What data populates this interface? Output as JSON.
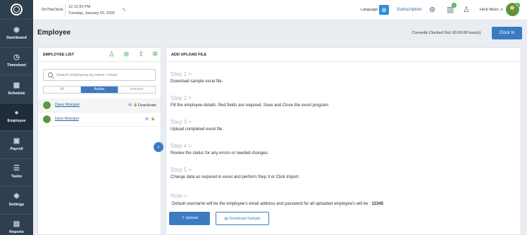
{
  "nav": [
    {
      "label": "Dashboard",
      "icon": "dashboard-icon"
    },
    {
      "label": "Timesheet",
      "icon": "clock-icon"
    },
    {
      "label": "Schedule",
      "icon": "calendar-icon"
    },
    {
      "label": "Employee",
      "icon": "people-icon",
      "active": true
    },
    {
      "label": "Payroll",
      "icon": "wallet-icon"
    },
    {
      "label": "Tasks",
      "icon": "tasks-icon"
    },
    {
      "label": "Settings",
      "icon": "gear-icon"
    },
    {
      "label": "Reports",
      "icon": "reports-icon"
    }
  ],
  "topbar": {
    "app_name": "OnTheClock",
    "time": "12:12:32 PM",
    "date": "Tuesday, January 20, 2026",
    "language_label": "Language",
    "subscription_label": "Subscription",
    "notification_count": "0",
    "user_count": "0",
    "user_name": "Herb Woer...",
    "avatar_badge": "0"
  },
  "page": {
    "title": "Employee",
    "clock_status": "Currently Clocked Out: 00:00:00 hour(s)",
    "clock_in_label": "Clock In"
  },
  "employee_list": {
    "title": "EMPLOYEE LIST",
    "search_placeholder": "Search employees by name / email",
    "filters": [
      "All",
      "Active",
      "Inactive"
    ],
    "active_filter": "Active",
    "employees": [
      {
        "name": "Dave Woerpel",
        "action": "Deactivate"
      },
      {
        "name": "Herb Woerpel",
        "action": ""
      }
    ]
  },
  "upload": {
    "title": "ADD UPLOAD FILE",
    "steps": [
      {
        "heading": "Step 1 >",
        "text": "Download sample excel file."
      },
      {
        "heading": "Step 2 >",
        "text": "Fill the employee details. Red fields are required. Save and Close the excel program."
      },
      {
        "heading": "Step 3 >",
        "text": "Upload completed excel file."
      },
      {
        "heading": "Step 4 >",
        "text": "Review the status for any errors or needed changes."
      },
      {
        "heading": "Step 5 >",
        "text": "Change data as required in excel and perform Step 3 or Click Import."
      }
    ],
    "note_heading": "Note >",
    "note_text": "Default username will be the employee's email address and password for all uploaded employee's will be :",
    "default_password": "12345",
    "upload_label": "Upload",
    "download_sample_label": "Download Sample"
  },
  "colors": {
    "primary": "#3c7bc2",
    "sidebar": "#2e3f50",
    "accent_green": "#4cae4c"
  }
}
